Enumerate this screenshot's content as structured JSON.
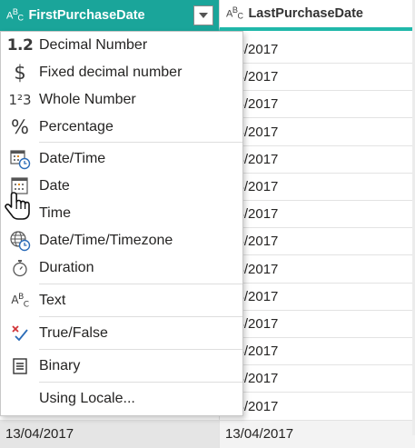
{
  "columns": {
    "first": {
      "type_icon": "abc-text-icon",
      "label": "FirstPurchaseDate"
    },
    "second": {
      "type_icon": "abc-text-icon",
      "label": "LastPurchaseDate"
    }
  },
  "rows": [
    {
      "c1": "",
      "c2": "/04/2017"
    },
    {
      "c1": "",
      "c2": "/04/2017"
    },
    {
      "c1": "",
      "c2": "/04/2017"
    },
    {
      "c1": "",
      "c2": "/04/2017"
    },
    {
      "c1": "",
      "c2": "/04/2017"
    },
    {
      "c1": "",
      "c2": "/04/2017"
    },
    {
      "c1": "",
      "c2": "/04/2017"
    },
    {
      "c1": "",
      "c2": "/04/2017"
    },
    {
      "c1": "",
      "c2": "/04/2017"
    },
    {
      "c1": "",
      "c2": "/04/2017"
    },
    {
      "c1": "",
      "c2": "/04/2017"
    },
    {
      "c1": "",
      "c2": "/04/2017"
    },
    {
      "c1": "",
      "c2": "/04/2017"
    },
    {
      "c1": "",
      "c2": "/04/2017"
    },
    {
      "c1": "13/04/2017",
      "c2": "13/04/2017"
    }
  ],
  "menu": {
    "items": [
      {
        "label": "Decimal Number",
        "icon": "decimal-number-icon",
        "glyph": "1.2"
      },
      {
        "label": "Fixed decimal number",
        "icon": "dollar-icon",
        "glyph": "$"
      },
      {
        "label": "Whole Number",
        "icon": "whole-number-icon",
        "glyph": "1²3"
      },
      {
        "label": "Percentage",
        "icon": "percent-icon",
        "glyph": "%"
      },
      {
        "label": "Date/Time",
        "icon": "datetime-icon"
      },
      {
        "label": "Date",
        "icon": "calendar-icon"
      },
      {
        "label": "Time",
        "icon": "clock-icon"
      },
      {
        "label": "Date/Time/Timezone",
        "icon": "globe-clock-icon"
      },
      {
        "label": "Duration",
        "icon": "stopwatch-icon"
      },
      {
        "label": "Text",
        "icon": "abc-text-icon"
      },
      {
        "label": "True/False",
        "icon": "true-false-icon"
      },
      {
        "label": "Binary",
        "icon": "binary-icon"
      },
      {
        "label": "Using Locale...",
        "icon": ""
      }
    ]
  },
  "colors": {
    "header_accent": "#1aa59a",
    "underline": "#20b8aa"
  }
}
